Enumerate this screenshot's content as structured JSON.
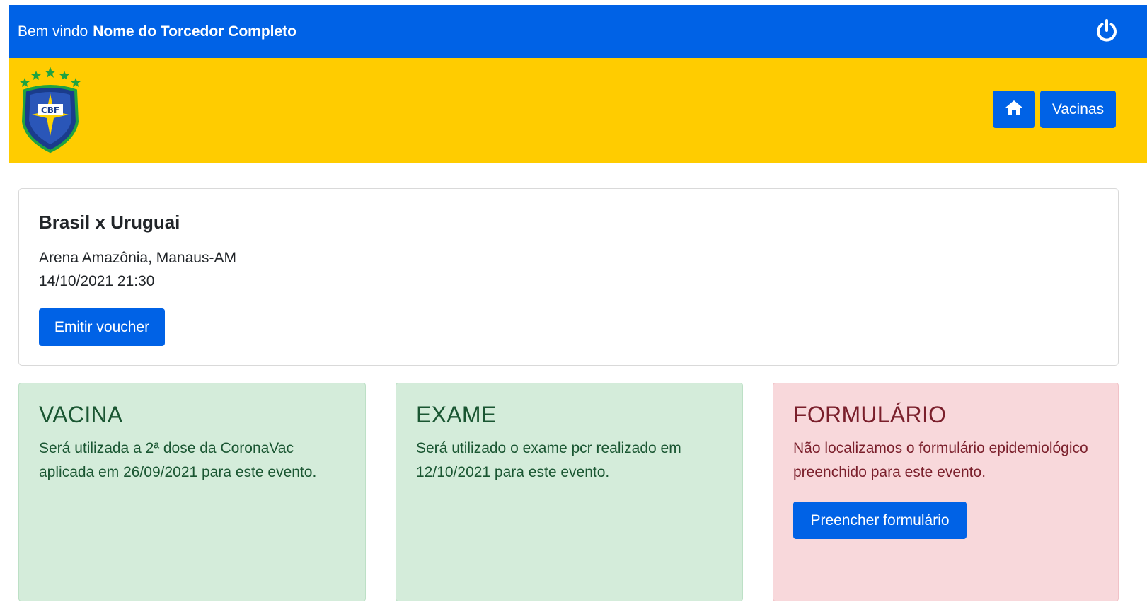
{
  "header": {
    "welcome_prefix": "Bem vindo",
    "user_name": "Nome do Torcedor Completo",
    "power_icon": "power-icon"
  },
  "nav": {
    "logo_text": "CBF",
    "home_icon": "home-icon",
    "vacinas_label": "Vacinas"
  },
  "event": {
    "title": "Brasil x Uruguai",
    "place": "Arena Amazônia, Manaus-AM",
    "datetime": "14/10/2021 21:30",
    "voucher_label": "Emitir voucher"
  },
  "status_cards": {
    "vacina": {
      "title": "VACINA",
      "text": "Será utilizada a 2ª dose da CoronaVac aplicada em 26/09/2021 para este evento."
    },
    "exame": {
      "title": "EXAME",
      "text": "Será utilizado o exame pcr realizado em 12/10/2021 para este evento."
    },
    "formulario": {
      "title": "FORMULÁRIO",
      "text": "Não localizamos o formulário epidemiológico preenchido para este evento.",
      "button_label": "Preencher formulário"
    }
  },
  "colors": {
    "primary_blue": "#0062e6",
    "brand_yellow": "#ffcc00",
    "success_bg": "#d4ecda",
    "danger_bg": "#f8d8db"
  }
}
